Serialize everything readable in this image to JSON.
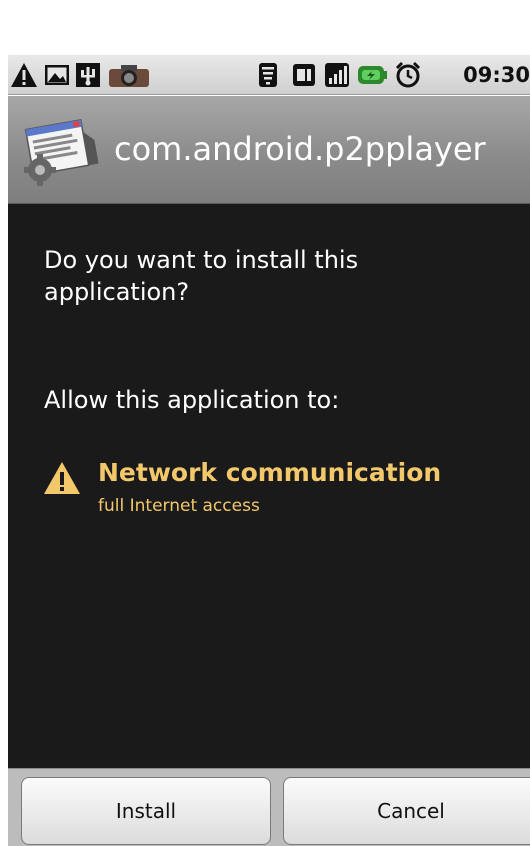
{
  "status_bar": {
    "time": "09:30",
    "icons": [
      "warning-icon",
      "image-icon",
      "usb-icon",
      "camera-icon",
      "wifi-icon",
      "sim-icon",
      "signal-icon",
      "battery-icon",
      "alarm-icon"
    ]
  },
  "dialog": {
    "package_name": "com.android.p2pplayer",
    "question": "Do you want to install this application?",
    "allow_label": "Allow this application to:",
    "permissions": [
      {
        "title": "Network communication",
        "description": "full Internet access"
      }
    ],
    "buttons": {
      "install": "Install",
      "cancel": "Cancel"
    }
  },
  "colors": {
    "content_bg": "#1a1a1a",
    "permission_text": "#f3c86b",
    "title_bar": "#8c8c8c"
  }
}
